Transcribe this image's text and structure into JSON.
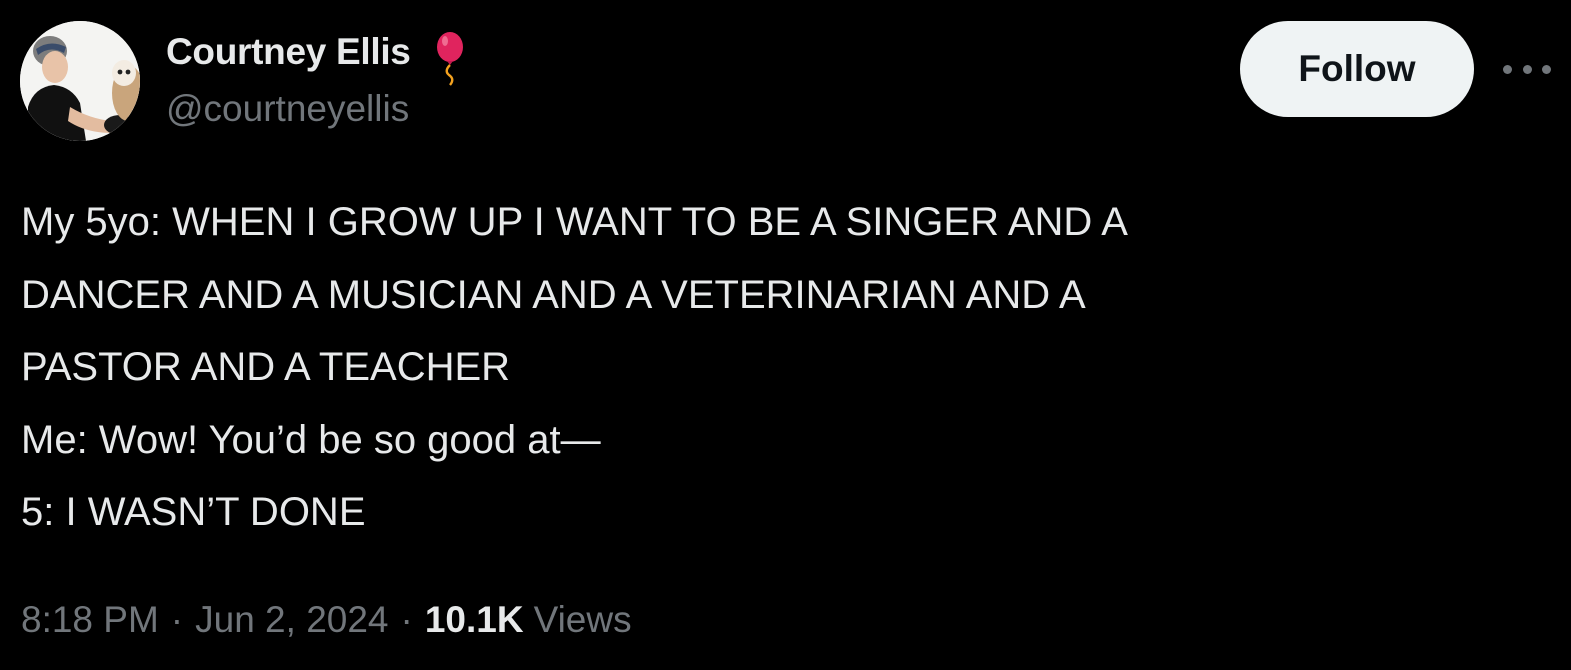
{
  "author": {
    "display_name": "Courtney Ellis",
    "handle": "@courtneyellis",
    "badge_icon": "balloon-icon",
    "avatar_icon": "avatar-photo"
  },
  "actions": {
    "follow_label": "Follow",
    "more_icon": "more-options-icon"
  },
  "tweet": {
    "lines": [
      "My 5yo: WHEN I GROW UP I WANT TO BE A SINGER AND A",
      "DANCER AND A MUSICIAN AND A VETERINARIAN AND A",
      "PASTOR AND A TEACHER",
      "Me: Wow! You’d be so good at—",
      "5: I WASN’T DONE"
    ]
  },
  "meta": {
    "time": "8:18 PM",
    "separator": "·",
    "date": "Jun 2, 2024",
    "views_count": "10.1K",
    "views_label": "Views"
  },
  "colors": {
    "background": "#000000",
    "primary_text": "#e7e9ea",
    "secondary_text": "#71767b",
    "follow_button_bg": "#eff3f4",
    "follow_button_text": "#0f1419",
    "balloon": "#e0245e"
  }
}
